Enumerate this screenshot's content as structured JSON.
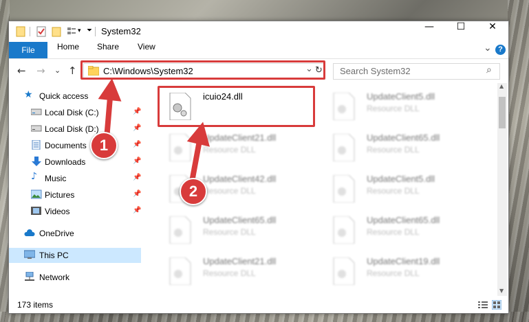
{
  "window": {
    "title": "System32",
    "controls": {
      "minimize": "—",
      "maximize": "☐",
      "close": "✕"
    }
  },
  "ribbon": {
    "tabs": [
      "File",
      "Home",
      "Share",
      "View"
    ],
    "expand_glyph": "⌄",
    "help_glyph": "?"
  },
  "navigation": {
    "back": "←",
    "forward": "→",
    "recent": "⌄",
    "up": "↑",
    "address": "C:\\Windows\\System32",
    "address_dropdown": "⌄",
    "refresh": "↻",
    "search_placeholder": "Search System32",
    "search_icon": "⌕"
  },
  "sidebar": {
    "quick_access": "Quick access",
    "items": [
      {
        "label": "Local Disk (C:)",
        "icon": "drive-icon"
      },
      {
        "label": "Local Disk (D:)",
        "icon": "drive-icon"
      },
      {
        "label": "Documents",
        "icon": "documents-icon"
      },
      {
        "label": "Downloads",
        "icon": "downloads-icon"
      },
      {
        "label": "Music",
        "icon": "music-icon"
      },
      {
        "label": "Pictures",
        "icon": "pictures-icon"
      },
      {
        "label": "Videos",
        "icon": "videos-icon"
      }
    ],
    "pin_glyph": "📌",
    "onedrive": "OneDrive",
    "this_pc": "This PC",
    "network": "Network"
  },
  "files": {
    "highlighted": {
      "name": "icuio24.dll"
    },
    "left_column": [
      {
        "name": "UpdateClient21.dll",
        "type": "Resource DLL"
      },
      {
        "name": "UpdateClient42.dll",
        "type": "Resource DLL"
      },
      {
        "name": "UpdateClient65.dll",
        "type": "Resource DLL"
      },
      {
        "name": "UpdateClient21.dll",
        "type": "Resource DLL"
      }
    ],
    "right_column": [
      {
        "name": "UpdateClient5.dll",
        "type": "Resource DLL"
      },
      {
        "name": "UpdateClient65.dll",
        "type": "Resource DLL"
      },
      {
        "name": "UpdateClient5.dll",
        "type": "Resource DLL"
      },
      {
        "name": "UpdateClient65.dll",
        "type": "Resource DLL"
      },
      {
        "name": "UpdateClient19.dll",
        "type": "Resource DLL"
      }
    ]
  },
  "status": {
    "item_count": "173 items"
  },
  "callouts": {
    "one": "1",
    "two": "2"
  },
  "colors": {
    "accent": "#1979ca",
    "highlight": "#d83b3b",
    "selection": "#cce8ff"
  }
}
